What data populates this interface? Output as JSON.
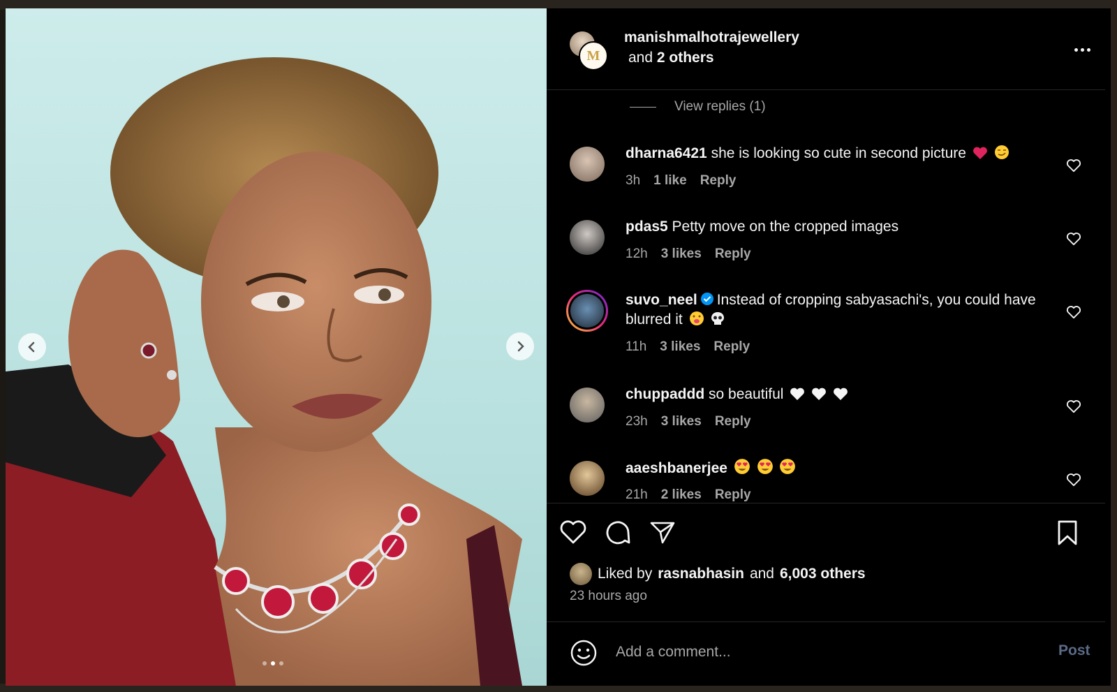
{
  "post": {
    "username": "manishmalhotrajewellery",
    "collab_prefix": "and",
    "collab_count": "2 others",
    "logo_letter": "M"
  },
  "view_replies_label": "View replies (1)",
  "comments": [
    {
      "user": "dharna6421",
      "text": "she is looking so cute in second picture",
      "emojis": [
        "red-heart",
        "smirk-face"
      ],
      "time": "3h",
      "likes": "1 like",
      "reply": "Reply",
      "verified": false
    },
    {
      "user": "pdas5",
      "text": "Petty move on the cropped images",
      "emojis": [],
      "time": "12h",
      "likes": "3 likes",
      "reply": "Reply",
      "verified": false
    },
    {
      "user": "suvo_neel",
      "text": "Instead of cropping sabyasachi's, you could have blurred it",
      "emojis": [
        "tongue-face",
        "skull"
      ],
      "time": "11h",
      "likes": "3 likes",
      "reply": "Reply",
      "verified": true
    },
    {
      "user": "chuppaddd",
      "text": "so beautiful",
      "emojis": [
        "white-heart",
        "white-heart",
        "white-heart"
      ],
      "time": "23h",
      "likes": "3 likes",
      "reply": "Reply",
      "verified": false
    },
    {
      "user": "aaeshbanerjee",
      "text": "",
      "emojis": [
        "heart-eyes",
        "heart-eyes",
        "heart-eyes"
      ],
      "time": "21h",
      "likes": "2 likes",
      "reply": "Reply",
      "verified": false
    }
  ],
  "likes_summary": {
    "prefix": "Liked by",
    "user": "rasnabhasin",
    "middle": "and",
    "count": "6,003 others"
  },
  "time_ago": "23 hours ago",
  "comment_box": {
    "placeholder": "Add a comment...",
    "post_label": "Post"
  },
  "carousel": {
    "current": 2,
    "total": 3
  },
  "colors": {
    "background": "#000000",
    "text": "#f5f5f5",
    "secondary_text": "#a8a8a8",
    "verified_blue": "#0095f6",
    "post_disabled": "#5a6b86"
  }
}
